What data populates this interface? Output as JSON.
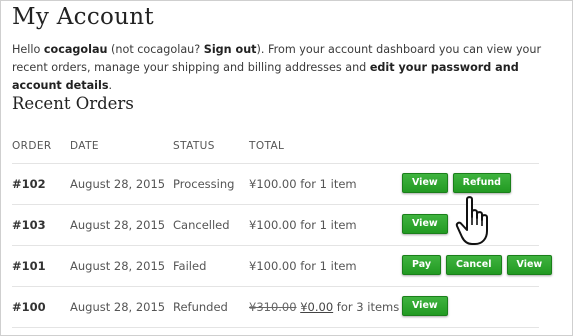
{
  "page": {
    "title": "My Account",
    "subtitle": "Recent Orders"
  },
  "intro": {
    "hello": "Hello ",
    "username": "cocagolau",
    "not_prefix": " (not cocagolau? ",
    "sign_out": "Sign out",
    "not_suffix": "). From your account dashboard you can view your recent orders, manage your shipping and billing addresses and ",
    "edit_link": "edit your password and account details",
    "end": "."
  },
  "table": {
    "headers": {
      "order": "ORDER",
      "date": "DATE",
      "status": "STATUS",
      "total": "TOTAL"
    },
    "rows": [
      {
        "order": "#102",
        "date": "August 28, 2015",
        "status": "Processing",
        "total": "¥100.00 for 1 item",
        "actions": [
          "View",
          "Refund"
        ]
      },
      {
        "order": "#103",
        "date": "August 28, 2015",
        "status": "Cancelled",
        "total": "¥100.00 for 1 item",
        "actions": [
          "View"
        ]
      },
      {
        "order": "#101",
        "date": "August 28, 2015",
        "status": "Failed",
        "total": "¥100.00 for 1 item",
        "actions": [
          "Pay",
          "Cancel",
          "View"
        ]
      },
      {
        "order": "#100",
        "date": "August 28, 2015",
        "status": "Refunded",
        "total_old": "¥310.00",
        "total_new": "¥0.00",
        "total_suffix": " for 3 items",
        "actions": [
          "View"
        ]
      }
    ]
  },
  "colors": {
    "button_green": "#2ba52b",
    "button_border": "#1a7f1a"
  },
  "icons": {
    "cursor": "hand-pointer-icon"
  }
}
